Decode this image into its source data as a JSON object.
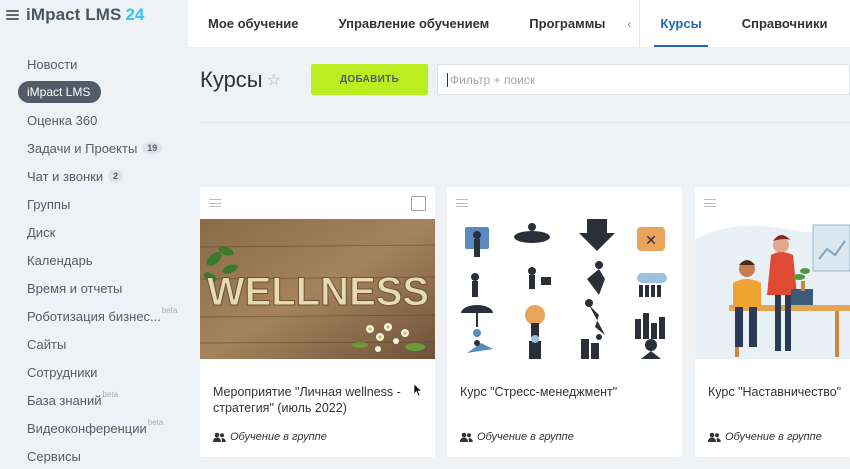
{
  "app": {
    "name": "iMpact LMS",
    "version": "24"
  },
  "sidebar": {
    "items": [
      {
        "label": "Новости"
      },
      {
        "label": "iMpact LMS",
        "active": true
      },
      {
        "label": "Оценка 360"
      },
      {
        "label": "Задачи и Проекты",
        "badge": "19"
      },
      {
        "label": "Чат и звонки",
        "badge": "2"
      },
      {
        "label": "Группы"
      },
      {
        "label": "Диск"
      },
      {
        "label": "Календарь"
      },
      {
        "label": "Время и отчеты"
      },
      {
        "label": "Роботизация бизнес...",
        "beta": "beta"
      },
      {
        "label": "Сайты"
      },
      {
        "label": "Сотрудники"
      },
      {
        "label": "База знаний",
        "beta": "beta"
      },
      {
        "label": "Видеоконференции",
        "beta": "beta"
      },
      {
        "label": "Сервисы"
      }
    ]
  },
  "topnav": {
    "tabs": [
      {
        "label": "Мое обучение"
      },
      {
        "label": "Управление обучением"
      },
      {
        "label": "Программы"
      },
      {
        "label": "Курсы",
        "active": true
      },
      {
        "label": "Справочники"
      }
    ],
    "chevron": "‹"
  },
  "page": {
    "title": "Курсы",
    "add_label": "Добавить",
    "search_placeholder": "Фильтр + поиск"
  },
  "cards": [
    {
      "title": "Мероприятие \"Личная wellness - стратегия\" (июль 2022)",
      "group": "Обучение в группе",
      "image_text": "WELLNESS"
    },
    {
      "title": "Курс \"Стресс-менеджмент\"",
      "group": "Обучение в группе"
    },
    {
      "title": "Курс \"Наставничество\"",
      "group": "Обучение в группе"
    }
  ],
  "colors": {
    "accent": "#2067b0",
    "add_button": "#bbed21",
    "logo_num": "#2fc6f6",
    "active_menu": "#525c69"
  }
}
